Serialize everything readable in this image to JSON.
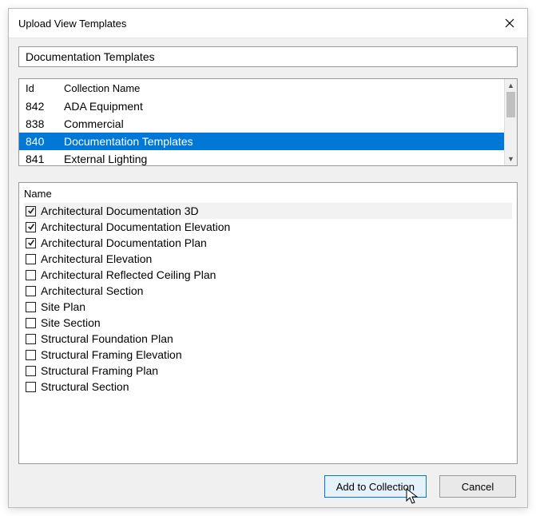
{
  "window": {
    "title": "Upload View Templates"
  },
  "search": {
    "value": "Documentation Templates"
  },
  "table": {
    "headers": {
      "id": "Id",
      "name": "Collection Name"
    },
    "rows": [
      {
        "id": "842",
        "name": "ADA Equipment",
        "selected": false
      },
      {
        "id": "838",
        "name": "Commercial",
        "selected": false
      },
      {
        "id": "840",
        "name": "Documentation Templates",
        "selected": true
      },
      {
        "id": "841",
        "name": "External Lighting",
        "selected": false
      }
    ]
  },
  "list": {
    "header": "Name",
    "items": [
      {
        "label": "Architectural Documentation 3D",
        "checked": true,
        "highlight": true
      },
      {
        "label": "Architectural Documentation Elevation",
        "checked": true,
        "highlight": false
      },
      {
        "label": "Architectural Documentation Plan",
        "checked": true,
        "highlight": false
      },
      {
        "label": "Architectural Elevation",
        "checked": false,
        "highlight": false
      },
      {
        "label": "Architectural Reflected Ceiling Plan",
        "checked": false,
        "highlight": false
      },
      {
        "label": "Architectural Section",
        "checked": false,
        "highlight": false
      },
      {
        "label": "Site Plan",
        "checked": false,
        "highlight": false
      },
      {
        "label": "Site Section",
        "checked": false,
        "highlight": false
      },
      {
        "label": "Structural Foundation Plan",
        "checked": false,
        "highlight": false
      },
      {
        "label": "Structural Framing Elevation",
        "checked": false,
        "highlight": false
      },
      {
        "label": "Structural Framing Plan",
        "checked": false,
        "highlight": false
      },
      {
        "label": "Structural Section",
        "checked": false,
        "highlight": false
      }
    ]
  },
  "buttons": {
    "add": "Add to Collection",
    "cancel": "Cancel"
  }
}
